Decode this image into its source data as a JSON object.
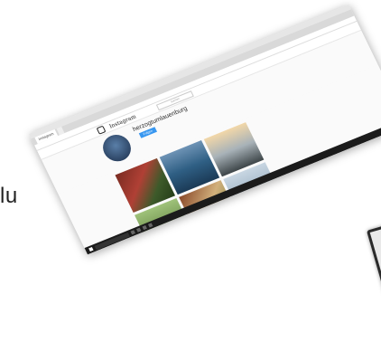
{
  "background_text": "lu",
  "browser": {
    "tabs": [
      {
        "label": "Instagram",
        "active": true
      },
      {
        "label": "",
        "active": false
      }
    ]
  },
  "instagram": {
    "logo_text": "Instagram",
    "search_placeholder": "Suchen",
    "username": "herzogtumlauenburg",
    "follow_label": "Folgen"
  },
  "photos": [
    "flowers-brick",
    "lake-water",
    "sunset-harbor",
    "trees",
    "village",
    "sky"
  ]
}
